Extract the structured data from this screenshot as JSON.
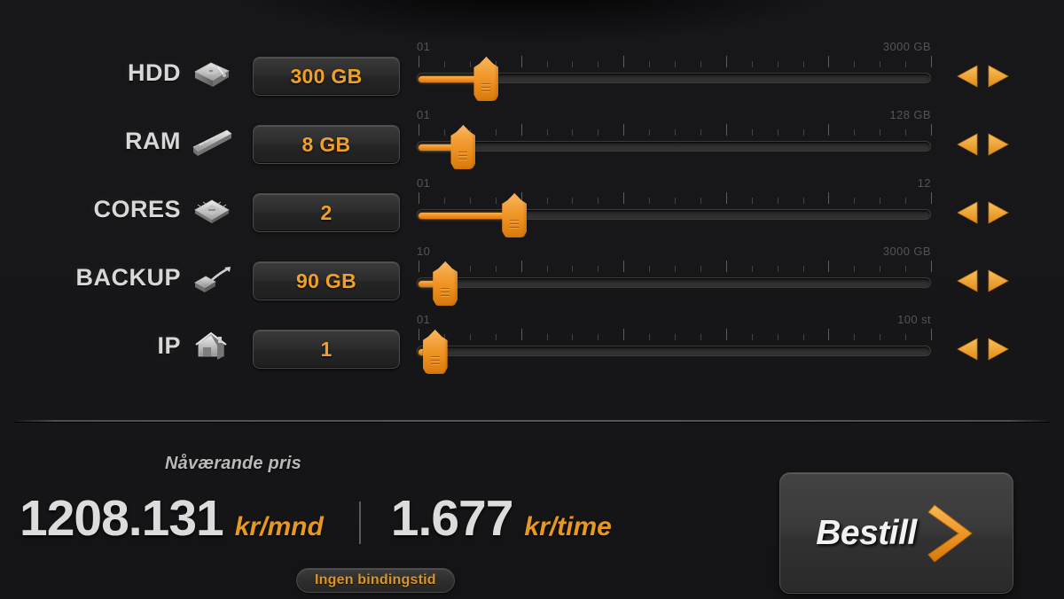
{
  "config": {
    "rows": [
      {
        "label": "HDD",
        "icon": "harddisk-icon",
        "value": "300 GB",
        "scale_min": "01",
        "scale_max": "3000 GB",
        "handle_percent": 11.5,
        "major_ticks": 5,
        "minor_per_major": 3
      },
      {
        "label": "RAM",
        "icon": "memory-module-icon",
        "value": "8 GB",
        "scale_min": "01",
        "scale_max": "128 GB",
        "handle_percent": 7.0,
        "major_ticks": 5,
        "minor_per_major": 3
      },
      {
        "label": "CORES",
        "icon": "cpu-chip-icon",
        "value": "2",
        "scale_min": "01",
        "scale_max": "12",
        "handle_percent": 17.0,
        "major_ticks": 5,
        "minor_per_major": 3
      },
      {
        "label": "BACKUP",
        "icon": "backup-drive-icon",
        "value": "90 GB",
        "scale_min": "10",
        "scale_max": "3000 GB",
        "handle_percent": 3.5,
        "major_ticks": 5,
        "minor_per_major": 3
      },
      {
        "label": "IP",
        "icon": "ip-network-icon",
        "value": "1",
        "scale_min": "01",
        "scale_max": "100 st",
        "handle_percent": 1.5,
        "major_ticks": 5,
        "minor_per_major": 3
      }
    ],
    "arrow_left_icon": "arrow-left-icon",
    "arrow_right_icon": "arrow-right-icon"
  },
  "footer": {
    "price_caption": "Nåværande pris",
    "price_monthly_amount": "1208.131",
    "price_monthly_unit": "kr/mnd",
    "price_hourly_amount": "1.677",
    "price_hourly_unit": "kr/time",
    "badge": "Ingen bindingstid",
    "order_label": "Bestill",
    "order_icon": "chevron-right-icon"
  },
  "colors": {
    "accent": "#ef8f1c",
    "accent_light": "#f9b863",
    "value_text": "#f0a028",
    "label_text": "#d8d8d8",
    "price_text": "#dcdcdc",
    "background": "#17171a"
  }
}
